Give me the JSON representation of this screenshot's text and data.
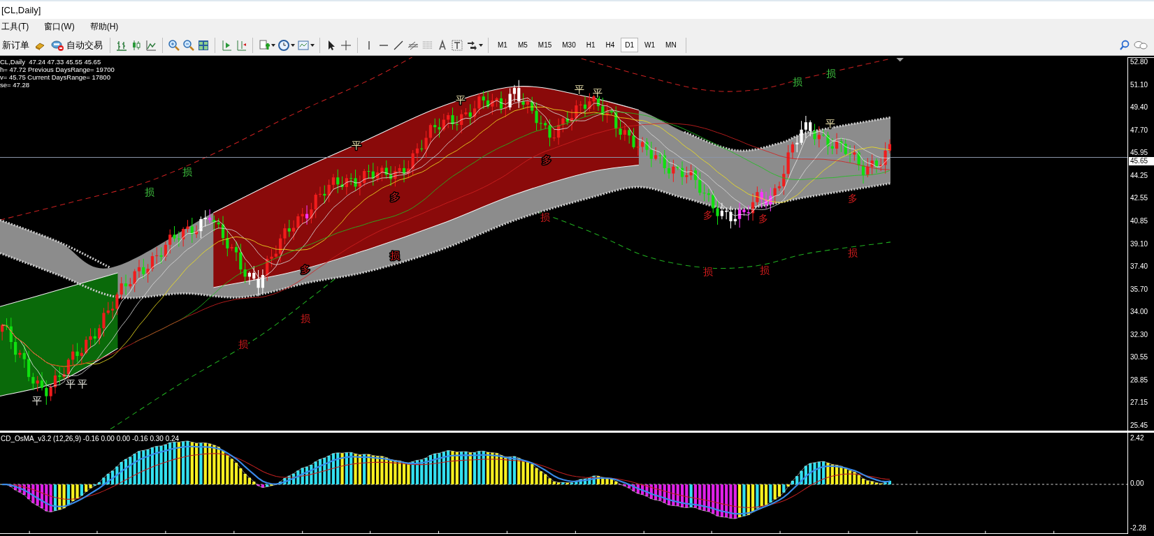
{
  "window": {
    "title": "[CL,Daily]"
  },
  "menu": [
    {
      "label": "工具(T)"
    },
    {
      "label": "窗口(W)"
    },
    {
      "label": "帮助(H)"
    }
  ],
  "toolbar": {
    "buttons": [
      {
        "label": "新订单"
      },
      {
        "label": "自动交易"
      }
    ],
    "timeframes": [
      {
        "label": "M1",
        "selected": false
      },
      {
        "label": "M5",
        "selected": false
      },
      {
        "label": "M15",
        "selected": false
      },
      {
        "label": "M30",
        "selected": false
      },
      {
        "label": "H1",
        "selected": false
      },
      {
        "label": "H4",
        "selected": false
      },
      {
        "label": "D1",
        "selected": true
      },
      {
        "label": "W1",
        "selected": false
      },
      {
        "label": "MN",
        "selected": false
      }
    ]
  },
  "chart": {
    "info_lines": [
      "CL,Daily  47.24 47.33 45.55 45.65",
      "h= 47.72 Previous DaysRange= 19700",
      "v= 45.75 Current DaysRange= 17800",
      "se= 47.28"
    ],
    "price_axis": [
      "52.80",
      "51.10",
      "49.40",
      "47.70",
      "45.95",
      "44.25",
      "42.55",
      "40.85",
      "39.10",
      "37.40",
      "35.70",
      "34.00",
      "32.30",
      "30.55",
      "28.85",
      "27.15",
      "25.45"
    ],
    "current_price": "45.65",
    "markers": [
      {
        "text": "损",
        "color": "#3fc03f"
      },
      {
        "text": "损",
        "color": "#3fc03f"
      },
      {
        "text": "损",
        "color": "#3fc03f"
      },
      {
        "text": "损",
        "color": "#3fc03f"
      },
      {
        "text": "损",
        "color": "#d01c1c"
      },
      {
        "text": "损",
        "color": "#d01c1c"
      },
      {
        "text": "损",
        "color": "#d01c1c"
      },
      {
        "text": "损",
        "color": "#d01c1c"
      },
      {
        "text": "损",
        "color": "#d01c1c"
      },
      {
        "text": "损",
        "color": "#d01c1c"
      },
      {
        "text": "损",
        "color": "#d01c1c"
      },
      {
        "text": "多",
        "color": "#d01c1c"
      },
      {
        "text": "多",
        "color": "#d01c1c"
      },
      {
        "text": "多",
        "color": "#d01c1c"
      },
      {
        "text": "多",
        "color": "#d01c1c"
      },
      {
        "text": "多",
        "color": "#d01c1c"
      },
      {
        "text": "多",
        "color": "#d01c1c"
      },
      {
        "text": "平",
        "color": "#f0f0e8"
      },
      {
        "text": "平",
        "color": "#f0f0e8"
      },
      {
        "text": "平",
        "color": "#f0f0e8"
      },
      {
        "text": "平",
        "color": "#f0e6b0"
      },
      {
        "text": "平",
        "color": "#f0e6b0"
      },
      {
        "text": "平",
        "color": "#f0e6b0"
      },
      {
        "text": "平",
        "color": "#f0e6b0"
      },
      {
        "text": "平",
        "color": "#f0e6b0"
      }
    ]
  },
  "indicator": {
    "title": "CD_OsMA_v3.2 (12,26,9) -0.16 0.00 0.00 -0.16 0.30 0.24",
    "axis": [
      "2.42",
      "0.00",
      "-2.28"
    ]
  }
}
